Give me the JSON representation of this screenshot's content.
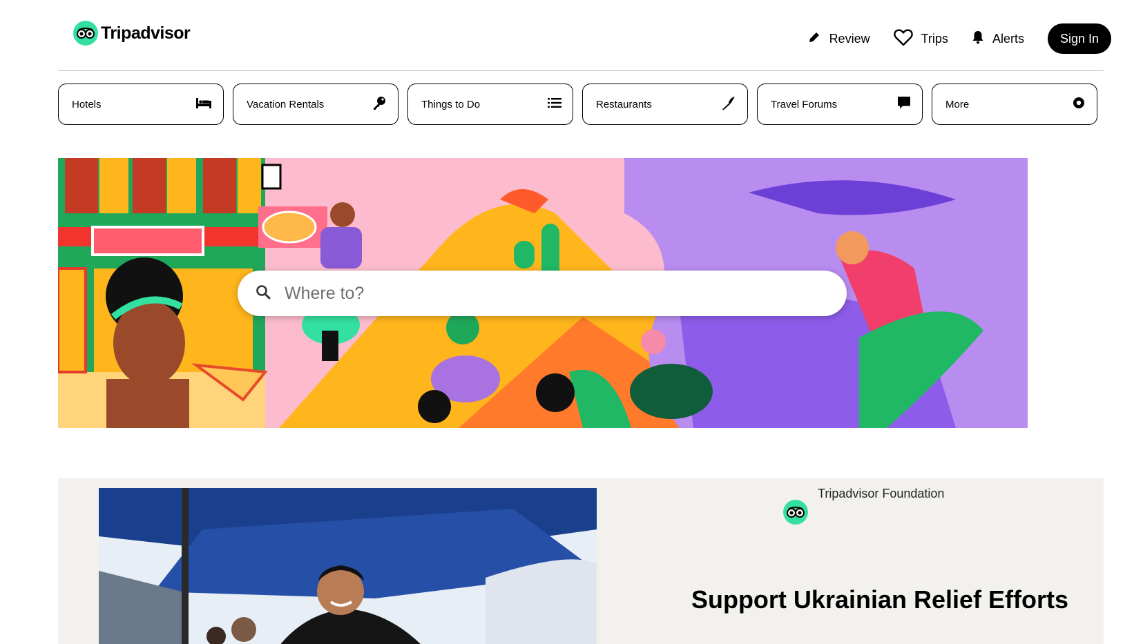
{
  "brand": {
    "name": "Tripadvisor",
    "icon": "owl-eyes-icon",
    "color": "#34e0a1"
  },
  "nav": {
    "review": {
      "label": "Review",
      "icon": "pencil-icon"
    },
    "trips": {
      "label": "Trips",
      "icon": "heart-icon"
    },
    "alerts": {
      "label": "Alerts",
      "icon": "bell-icon"
    },
    "signin": "Sign In"
  },
  "categories": [
    {
      "label": "Hotels",
      "icon": "bed-icon"
    },
    {
      "label": "Vacation Rentals",
      "icon": "key-icon"
    },
    {
      "label": "Things to Do",
      "icon": "list-icon"
    },
    {
      "label": "Restaurants",
      "icon": "knife-icon"
    },
    {
      "label": "Travel Forums",
      "icon": "speech-bubble-icon"
    },
    {
      "label": "More",
      "icon": "circle-dot-icon"
    }
  ],
  "search": {
    "placeholder": "Where to?",
    "icon": "search-icon"
  },
  "promo": {
    "foundation_label": "Tripadvisor Foundation",
    "title": "Support Ukrainian Relief Efforts"
  }
}
